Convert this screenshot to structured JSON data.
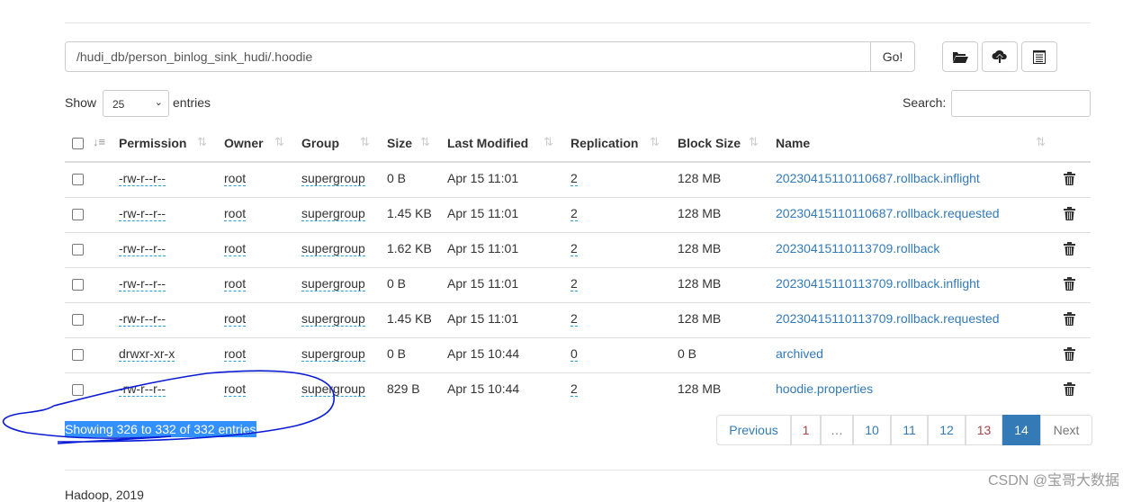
{
  "path_input": {
    "value": "/hudi_db/person_binlog_sink_hudi/.hoodie",
    "go_label": "Go!"
  },
  "toolbar": {
    "icons": [
      "folder-open-icon",
      "cloud-upload-icon",
      "list-icon"
    ]
  },
  "length": {
    "show_label": "Show",
    "value": "25",
    "entries_label": "entries"
  },
  "search": {
    "label": "Search:",
    "value": ""
  },
  "columns": [
    "Permission",
    "Owner",
    "Group",
    "Size",
    "Last Modified",
    "Replication",
    "Block Size",
    "Name"
  ],
  "rows": [
    {
      "permission": "-rw-r--r--",
      "owner": "root",
      "group": "supergroup",
      "size": "0 B",
      "modified": "Apr 15 11:01",
      "replication": "2",
      "block_size": "128 MB",
      "name": "20230415110110687.rollback.inflight"
    },
    {
      "permission": "-rw-r--r--",
      "owner": "root",
      "group": "supergroup",
      "size": "1.45 KB",
      "modified": "Apr 15 11:01",
      "replication": "2",
      "block_size": "128 MB",
      "name": "20230415110110687.rollback.requested"
    },
    {
      "permission": "-rw-r--r--",
      "owner": "root",
      "group": "supergroup",
      "size": "1.62 KB",
      "modified": "Apr 15 11:01",
      "replication": "2",
      "block_size": "128 MB",
      "name": "20230415110113709.rollback"
    },
    {
      "permission": "-rw-r--r--",
      "owner": "root",
      "group": "supergroup",
      "size": "0 B",
      "modified": "Apr 15 11:01",
      "replication": "2",
      "block_size": "128 MB",
      "name": "20230415110113709.rollback.inflight"
    },
    {
      "permission": "-rw-r--r--",
      "owner": "root",
      "group": "supergroup",
      "size": "1.45 KB",
      "modified": "Apr 15 11:01",
      "replication": "2",
      "block_size": "128 MB",
      "name": "20230415110113709.rollback.requested"
    },
    {
      "permission": "drwxr-xr-x",
      "owner": "root",
      "group": "supergroup",
      "size": "0 B",
      "modified": "Apr 15 10:44",
      "replication": "0",
      "block_size": "0 B",
      "name": "archived"
    },
    {
      "permission": "-rw-r--r--",
      "owner": "root",
      "group": "supergroup",
      "size": "829 B",
      "modified": "Apr 15 10:44",
      "replication": "2",
      "block_size": "128 MB",
      "name": "hoodie.properties"
    }
  ],
  "info": "Showing 326 to 332 of 332 entries",
  "pagination": [
    "Previous",
    "1",
    "…",
    "10",
    "11",
    "12",
    "13",
    "14",
    "Next"
  ],
  "pagination_active": "14",
  "footer": "Hadoop, 2019",
  "watermark": "CSDN @宝哥大数据",
  "colors": {
    "link": "#337ab7",
    "active_page": "#337ab7",
    "selection": "#3390ff",
    "annotation": "#0a1bd6"
  }
}
